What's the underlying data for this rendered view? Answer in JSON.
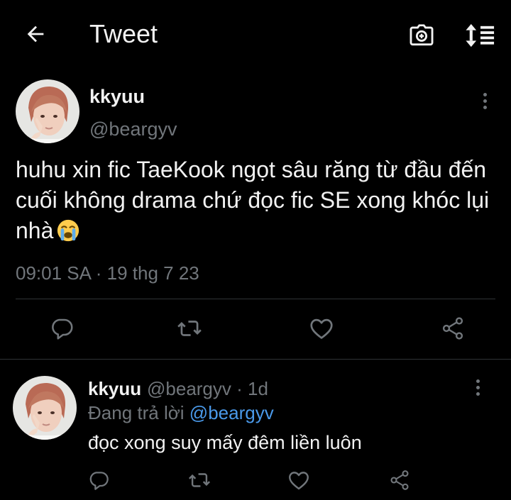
{
  "header": {
    "title": "Tweet",
    "back_icon": "arrow-left-icon",
    "camera_icon": "camera-icon",
    "sort_icon": "sort-icon"
  },
  "tweet": {
    "author_name": "kkyuu",
    "handle": "@beargyv",
    "text": "huhu xin fic TaeKook ngọt sâu răng từ đầu đến cuối không drama chứ đọc fic SE xong khóc lụi nhà",
    "emoji": "loudly-crying-face-icon",
    "timestamp": "09:01 SA · 19 thg 7 23",
    "actions": [
      "reply-icon",
      "retweet-icon",
      "like-icon",
      "share-icon"
    ]
  },
  "reply": {
    "author_name": "kkyuu",
    "handle_time": "@beargyv · 1d",
    "replying_prefix": "Đang trả lời",
    "replying_to": "@beargyv",
    "text": "đọc xong suy mấy đêm liền luôn",
    "actions": [
      "reply-icon",
      "retweet-icon",
      "like-icon",
      "share-icon"
    ]
  },
  "colors": {
    "background": "#000000",
    "text": "#f2f2f2",
    "secondary": "#71767b",
    "link": "#4a99e9",
    "divider": "#2f3336"
  }
}
